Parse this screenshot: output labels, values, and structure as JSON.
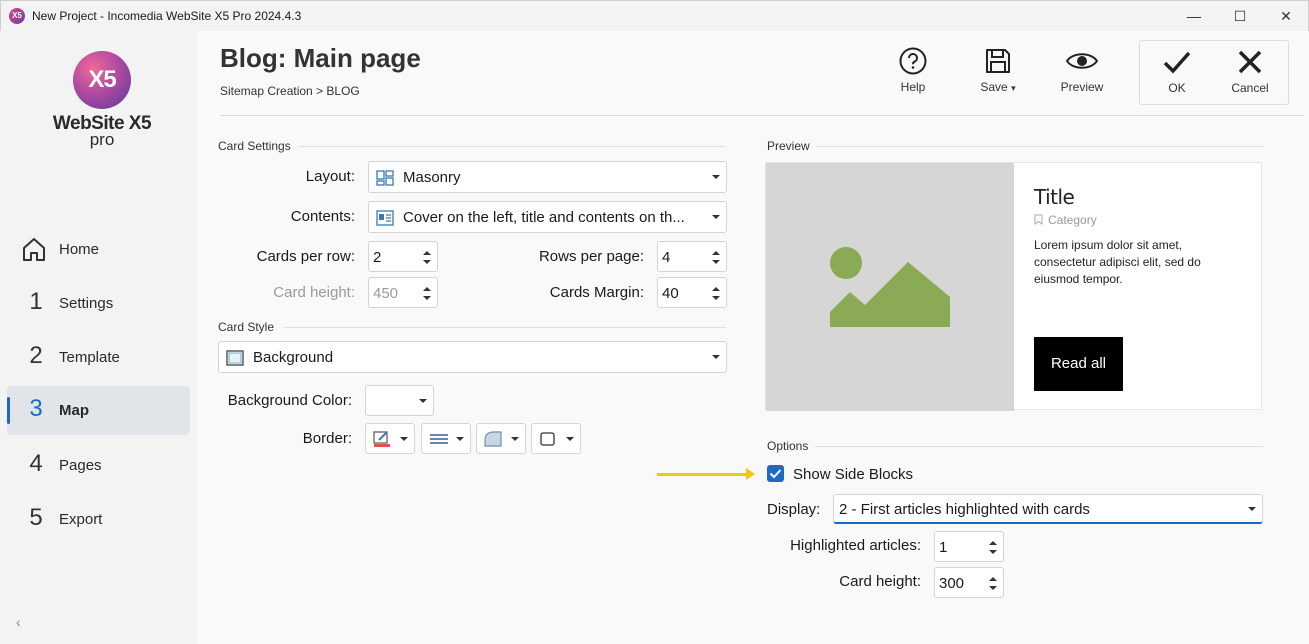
{
  "window": {
    "title": "New Project - Incomedia WebSite X5 Pro 2024.4.3",
    "app_icon_text": "X5",
    "minimize": "—",
    "maximize": "☐",
    "close": "✕"
  },
  "logo": {
    "mark": "X5",
    "name": "WebSite X5",
    "edition": "pro"
  },
  "sidebar": {
    "items": [
      {
        "num": "",
        "label": "Home"
      },
      {
        "num": "1",
        "label": "Settings"
      },
      {
        "num": "2",
        "label": "Template"
      },
      {
        "num": "3",
        "label": "Map"
      },
      {
        "num": "4",
        "label": "Pages"
      },
      {
        "num": "5",
        "label": "Export"
      }
    ],
    "active": "Map",
    "collapse_glyph": "‹"
  },
  "header": {
    "title": "Blog: Main page",
    "breadcrumb": "Sitemap Creation > BLOG"
  },
  "toolbar": {
    "help": "Help",
    "save": "Save",
    "save_caret": "▾",
    "preview": "Preview",
    "ok": "OK",
    "cancel": "Cancel"
  },
  "card_settings": {
    "section": "Card Settings",
    "layout_label": "Layout:",
    "layout_value": "Masonry",
    "contents_label": "Contents:",
    "contents_value": "Cover on the left, title and contents on th...",
    "cards_per_row_label": "Cards per row:",
    "cards_per_row": "2",
    "rows_per_page_label": "Rows per page:",
    "rows_per_page": "4",
    "card_height_label": "Card height:",
    "card_height": "450",
    "cards_margin_label": "Cards Margin:",
    "cards_margin": "40"
  },
  "card_style": {
    "section": "Card Style",
    "style_value": "Background",
    "bg_color_label": "Background Color:",
    "border_label": "Border:"
  },
  "preview": {
    "section": "Preview",
    "title": "Title",
    "category": "Category",
    "text": "Lorem ipsum dolor sit amet, consectetur adipisci elit, sed do eiusmod tempor.",
    "button": "Read all"
  },
  "options": {
    "section": "Options",
    "show_side_blocks_label": "Show Side Blocks",
    "show_side_blocks": true,
    "display_label": "Display:",
    "display_value": "2 - First articles highlighted with cards",
    "highlighted_label": "Highlighted articles:",
    "highlighted_value": "1",
    "card_height_label": "Card height:",
    "card_height_value": "300"
  },
  "colors": {
    "accent": "#1a6bc4",
    "arrow": "#f2c80a",
    "image_placeholder": "#d6d6d6",
    "image_icon": "#8aaa55"
  }
}
